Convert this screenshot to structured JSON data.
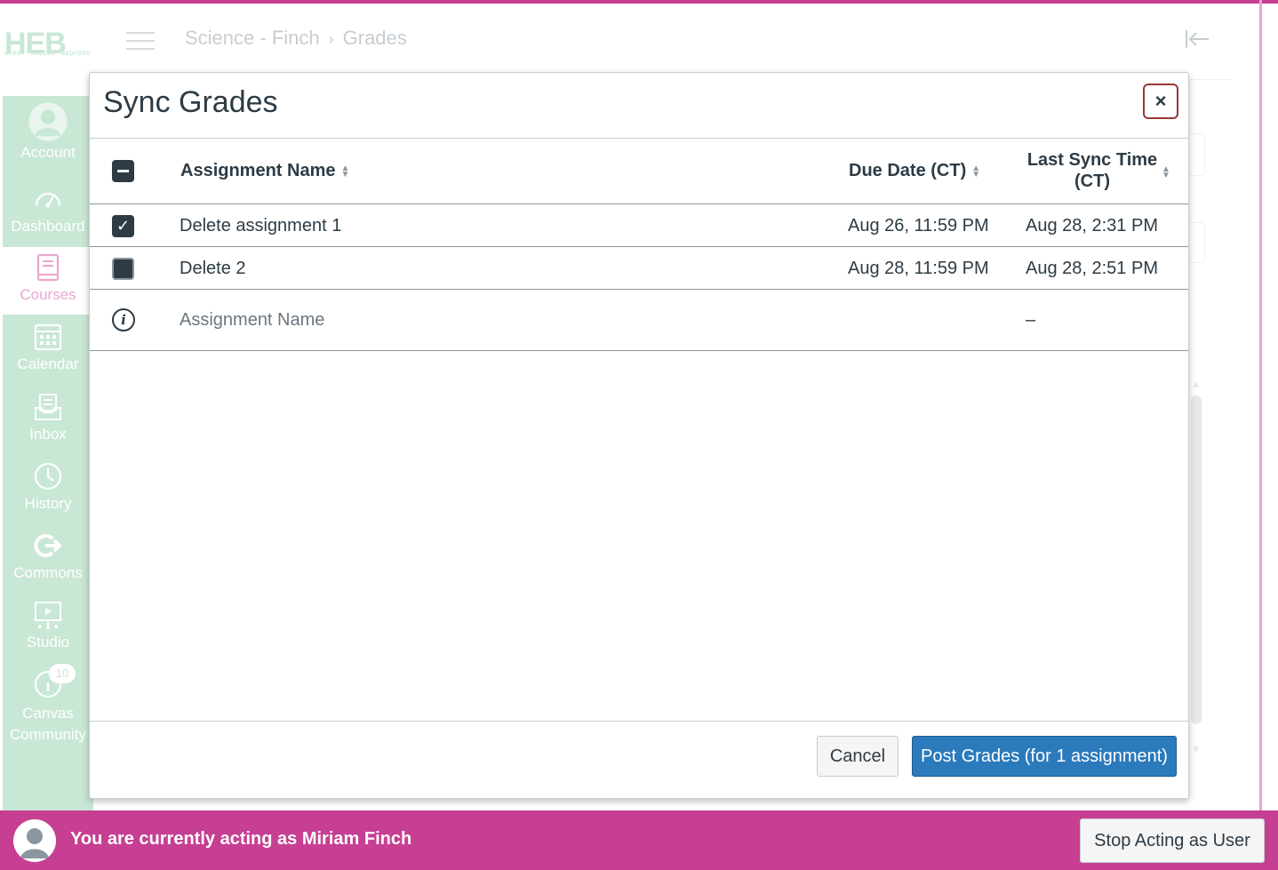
{
  "brand": {
    "logo_text": "HEB",
    "logo_sub": "HURST · EULESS · BEDFORD"
  },
  "nav": {
    "items": [
      {
        "label": "Account",
        "icon": "user-icon"
      },
      {
        "label": "Dashboard",
        "icon": "dashboard-icon"
      },
      {
        "label": "Courses",
        "icon": "book-icon"
      },
      {
        "label": "Calendar",
        "icon": "calendar-icon"
      },
      {
        "label": "Inbox",
        "icon": "inbox-icon"
      },
      {
        "label": "History",
        "icon": "clock-icon"
      },
      {
        "label": "Commons",
        "icon": "commons-icon"
      },
      {
        "label": "Studio",
        "icon": "studio-icon"
      },
      {
        "label": "Canvas Community",
        "icon": "help-icon",
        "badge": "10"
      }
    ]
  },
  "breadcrumb": {
    "course": "Science - Finch",
    "page": "Grades"
  },
  "modal": {
    "title": "Sync Grades",
    "close_label": "×",
    "columns": {
      "name": "Assignment Name",
      "due": "Due Date (CT)",
      "sync_line1": "Last Sync Time",
      "sync_line2": "(CT)"
    },
    "rows": [
      {
        "name": "Delete assignment 1",
        "due": "Aug 26, 11:59 PM",
        "sync": "Aug 28, 2:31 PM",
        "checked": true
      },
      {
        "name": "Delete 2",
        "due": "Aug 28, 11:59 PM",
        "sync": "Aug 28, 2:51 PM",
        "checked": false
      }
    ],
    "info_row": {
      "name": "Assignment Name",
      "sync": "–"
    },
    "cancel_label": "Cancel",
    "post_label": "Post Grades (for 1 assignment)"
  },
  "masquerade": {
    "text": "You are currently acting as Miriam Finch",
    "stop_label": "Stop Acting as User"
  },
  "colors": {
    "masquerade": "#c63f92",
    "nav_bg": "#c9e7d5",
    "primary": "#2b7abc",
    "text": "#2d3b45"
  }
}
